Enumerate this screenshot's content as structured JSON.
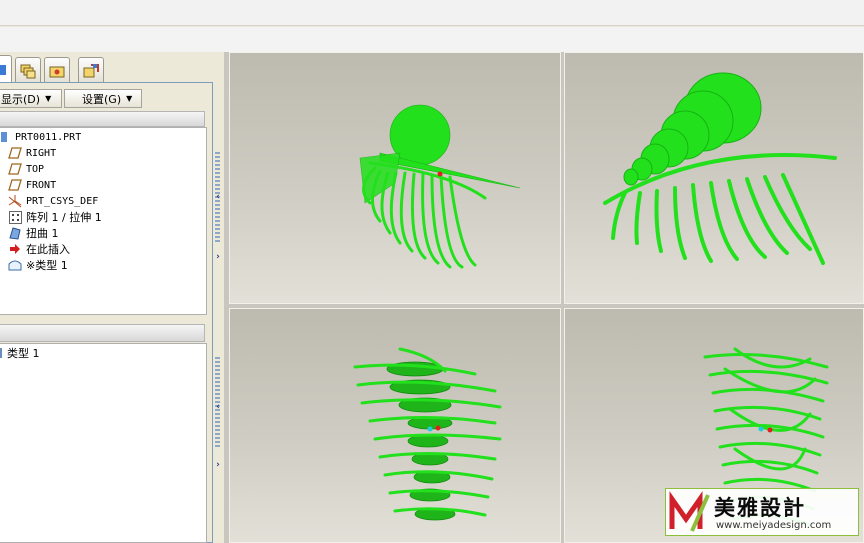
{
  "app": {
    "menu": {
      "display_label": "显示(D)",
      "settings_label": "设置(G)"
    },
    "model_tree": {
      "items": [
        {
          "label": "PRT0011.PRT",
          "icon": "part-icon"
        },
        {
          "label": "RIGHT",
          "icon": "datum-plane-icon"
        },
        {
          "label": "TOP",
          "icon": "datum-plane-icon"
        },
        {
          "label": "FRONT",
          "icon": "datum-plane-icon"
        },
        {
          "label": "PRT_CSYS_DEF",
          "icon": "csys-icon"
        },
        {
          "label": "阵列 1 / 拉伸 1",
          "icon": "pattern-icon"
        },
        {
          "label": "扭曲 1",
          "icon": "warp-icon"
        },
        {
          "label": "在此插入",
          "icon": "insert-here-icon"
        },
        {
          "label": "※类型 1",
          "icon": "feature-icon"
        }
      ]
    },
    "layer_tree": {
      "items": [
        {
          "label": "类型 1"
        }
      ]
    },
    "watermark": {
      "text": "美雅設計",
      "url": "www.meiyadesign.com"
    },
    "colors": {
      "model_green": "#22e01c",
      "viewport_bg_top": "#bdbbaf",
      "viewport_bg_bottom": "#e2e0d7"
    }
  }
}
